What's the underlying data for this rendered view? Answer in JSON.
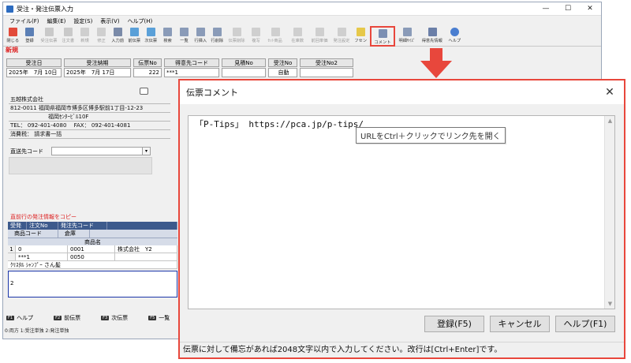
{
  "main_window": {
    "title": "受注・発注伝票入力",
    "menu": [
      "ファイル(F)",
      "編集(E)",
      "設定(S)",
      "表示(V)",
      "ヘルプ(H)"
    ],
    "toolbar": [
      "閉じる",
      "登録",
      "受注伝票",
      "注文書",
      "新規",
      "修正",
      "入力前",
      "前伝票",
      "次伝票",
      "検索",
      "一覧",
      "行挿入",
      "行削除",
      "伝票削除",
      "複写",
      "ｾｯﾄ商品",
      "在庫数",
      "前回単価",
      "発注設定",
      "フセン",
      "コメント",
      "明細ｻｲｽﾞ",
      "得意先情報",
      "ヘルプ"
    ],
    "mode": "新規",
    "headers": {
      "order_date": "受注日",
      "delivery_date": "受注納期",
      "slip_no": "伝票No",
      "customer_code": "得意先コード",
      "estimate_no": "見積No",
      "order_no": "受注No",
      "order_no2": "受注No2"
    },
    "values": {
      "order_date": "2025年　7月 10日",
      "delivery_date": "2025年　7月 17日",
      "slip_no": "222",
      "customer_code": "***1",
      "order_no": "自動"
    },
    "customer": {
      "name": "五越株式会社",
      "address1": "812-0011 福岡県福岡市博多区博多駅前1丁目-12-23",
      "address2": "福岡ｾﾝﾀｰﾋﾞﾙ10F",
      "phone": "TEL： 092-401-4080　 FAX： 092-401-4081",
      "tax": "消費税： 請求書一括"
    },
    "dest_label": "直送先コード",
    "copy_label": "直前行の発注情報をコピー",
    "grid": {
      "head1": [
        "受発",
        "注文No",
        "発注先コード"
      ],
      "head2": [
        "商品コード",
        "倉庫"
      ],
      "head3": "商品名",
      "row1": [
        "0",
        "0001",
        "株式会社　Y2"
      ],
      "row1b": [
        "***1",
        "0050"
      ],
      "row1c": "ｸﾘｽﾀﾙ ｼｬﾝﾌﾟｰ さん髪",
      "row_nums": [
        "1",
        "2"
      ]
    },
    "fkeys": [
      {
        "key": "F1",
        "label": "ヘルプ"
      },
      {
        "key": "F2",
        "label": "前伝票"
      },
      {
        "key": "F3",
        "label": "次伝票"
      },
      {
        "key": "F5",
        "label": "一覧"
      }
    ],
    "status": "0:両方 1:受注単独 2:発注単独"
  },
  "dialog": {
    "title": "伝票コメント",
    "text": "「P-Tips」 https://pca.jp/p-tips/",
    "tooltip": "URLをCtrl＋クリックでリンク先を開く",
    "buttons": {
      "ok": "登録(F5)",
      "cancel": "キャンセル",
      "help": "ヘルプ(F1)"
    },
    "status": "伝票に対して備忘があれば2048文字以内で入力してください。改行は[Ctrl+Enter]です。"
  },
  "colors": {
    "highlight": "#e8473c",
    "grid_header": "#3d5a8c",
    "mode_red": "#dd2222"
  }
}
